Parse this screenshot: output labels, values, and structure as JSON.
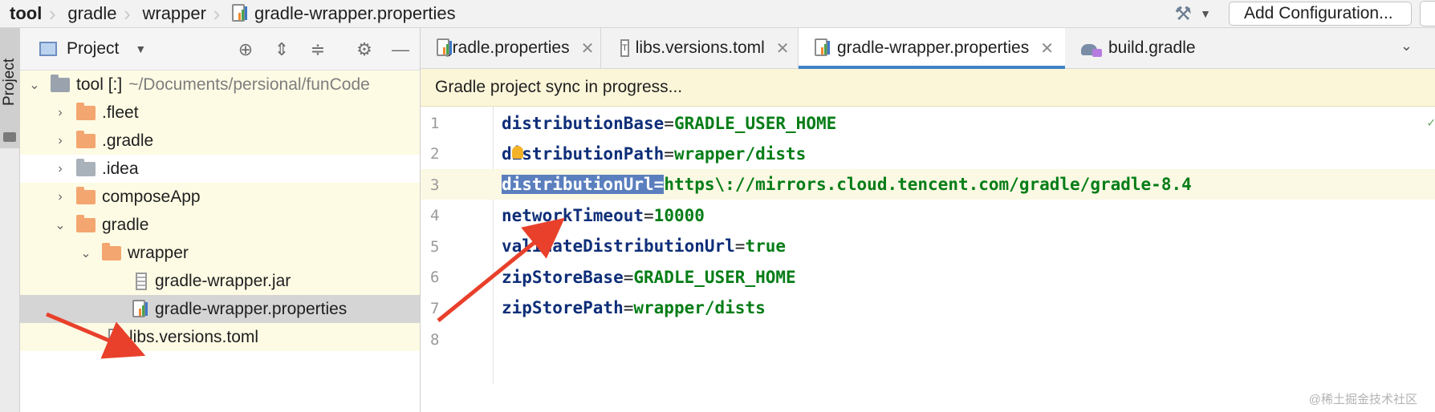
{
  "breadcrumb": [
    {
      "label": "tool",
      "bold": true
    },
    {
      "label": "gradle"
    },
    {
      "label": "wrapper"
    },
    {
      "label": "gradle-wrapper.properties",
      "icon": "properties-file-icon"
    }
  ],
  "toolbar": {
    "build_icon": "hammer-icon",
    "add_config_label": "Add Configuration..."
  },
  "toolstrip": {
    "project_tab_label": "Project"
  },
  "project_panel": {
    "title": "Project",
    "header_icons": [
      "crosshair-icon",
      "expand-all-icon",
      "collapse-all-icon",
      "gear-icon",
      "minimize-icon"
    ],
    "tree": [
      {
        "label": "tool [:]",
        "suffix": "~/Documents/persional/funCode",
        "expanded": true,
        "indent": 0,
        "icon": "module-folder-icon"
      },
      {
        "label": ".fleet",
        "expanded": false,
        "indent": 1,
        "icon": "folder-icon"
      },
      {
        "label": ".gradle",
        "expanded": false,
        "indent": 1,
        "icon": "folder-icon"
      },
      {
        "label": ".idea",
        "expanded": false,
        "indent": 1,
        "icon": "folder-icon"
      },
      {
        "label": "composeApp",
        "expanded": false,
        "indent": 1,
        "icon": "folder-icon"
      },
      {
        "label": "gradle",
        "expanded": true,
        "indent": 1,
        "icon": "folder-icon"
      },
      {
        "label": "wrapper",
        "expanded": true,
        "indent": 2,
        "icon": "folder-icon"
      },
      {
        "label": "gradle-wrapper.jar",
        "indent": 3,
        "icon": "jar-file-icon"
      },
      {
        "label": "gradle-wrapper.properties",
        "indent": 3,
        "icon": "properties-file-icon",
        "selected": true
      },
      {
        "label": "libs.versions.toml",
        "indent": 2,
        "icon": "toml-file-icon"
      }
    ]
  },
  "editor": {
    "tabs": [
      {
        "label": "gradle.properties",
        "icon": "properties-file-icon",
        "active": false
      },
      {
        "label": "libs.versions.toml",
        "icon": "toml-file-icon",
        "active": false
      },
      {
        "label": "gradle-wrapper.properties",
        "icon": "properties-file-icon",
        "active": true
      },
      {
        "label": "build.gradle",
        "icon": "gradle-kts-icon",
        "active": false
      }
    ],
    "banner": "Gradle project sync in progress...",
    "lines": [
      {
        "n": "1",
        "key": "distributionBase",
        "value": "GRADLE_USER_HOME"
      },
      {
        "n": "2",
        "key": "distributionPath",
        "value": "wrapper/dists"
      },
      {
        "n": "3",
        "key": "distributionUrl",
        "value": "https\\://mirrors.cloud.tencent.com/gradle/gradle-8.4",
        "selected": true
      },
      {
        "n": "4",
        "key": "networkTimeout",
        "value": "10000"
      },
      {
        "n": "5",
        "key": "validateDistributionUrl",
        "value": "true"
      },
      {
        "n": "6",
        "key": "zipStoreBase",
        "value": "GRADLE_USER_HOME"
      },
      {
        "n": "7",
        "key": "zipStorePath",
        "value": "wrapper/dists"
      },
      {
        "n": "8",
        "key": "",
        "value": ""
      }
    ]
  },
  "watermark": "@稀土掘金技术社区",
  "colors": {
    "annotation_arrow": "#e8402b",
    "active_tab_underline": "#4083c9",
    "key": "#0e2e78",
    "value": "#067d17"
  }
}
